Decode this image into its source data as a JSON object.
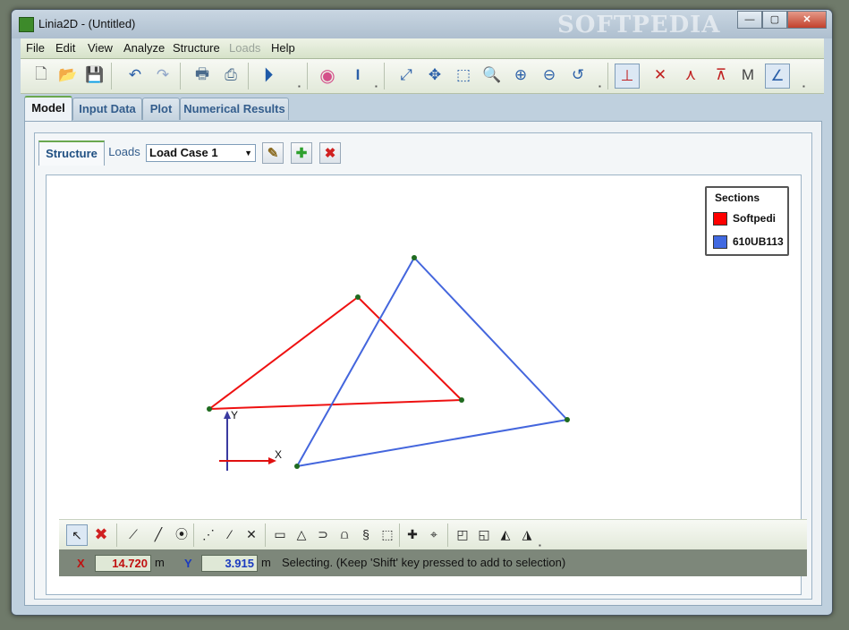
{
  "window": {
    "title": "Linia2D - (Untitled)",
    "watermark": "SOFTPEDIA"
  },
  "menu": [
    {
      "label": "File",
      "enabled": true
    },
    {
      "label": "Edit",
      "enabled": true
    },
    {
      "label": "View",
      "enabled": true
    },
    {
      "label": "Analyze",
      "enabled": true
    },
    {
      "label": "Structure",
      "enabled": true
    },
    {
      "label": "Loads",
      "enabled": false
    },
    {
      "label": "Help",
      "enabled": true
    }
  ],
  "main_tabs": [
    "Model",
    "Input Data",
    "Plot",
    "Numerical Results"
  ],
  "sub_tabs": {
    "structure": "Structure",
    "loads": "Loads"
  },
  "load_case": {
    "selected": "Load Case 1"
  },
  "legend": {
    "title": "Sections",
    "items": [
      {
        "label": "Softpedi",
        "color": "#ff0000"
      },
      {
        "label": "610UB113",
        "color": "#4169e1"
      }
    ]
  },
  "axes_labels": {
    "x": "X",
    "y": "Y"
  },
  "status": {
    "x_label": "X",
    "x_value": "14.720",
    "x_unit": "m",
    "y_label": "Y",
    "y_value": "3.915",
    "y_unit": "m",
    "message": "Selecting. (Keep 'Shift' key pressed to add to selection)"
  },
  "colors": {
    "member_red": "#ee1111",
    "member_blue": "#4466dd",
    "node": "#1f6b1f"
  }
}
